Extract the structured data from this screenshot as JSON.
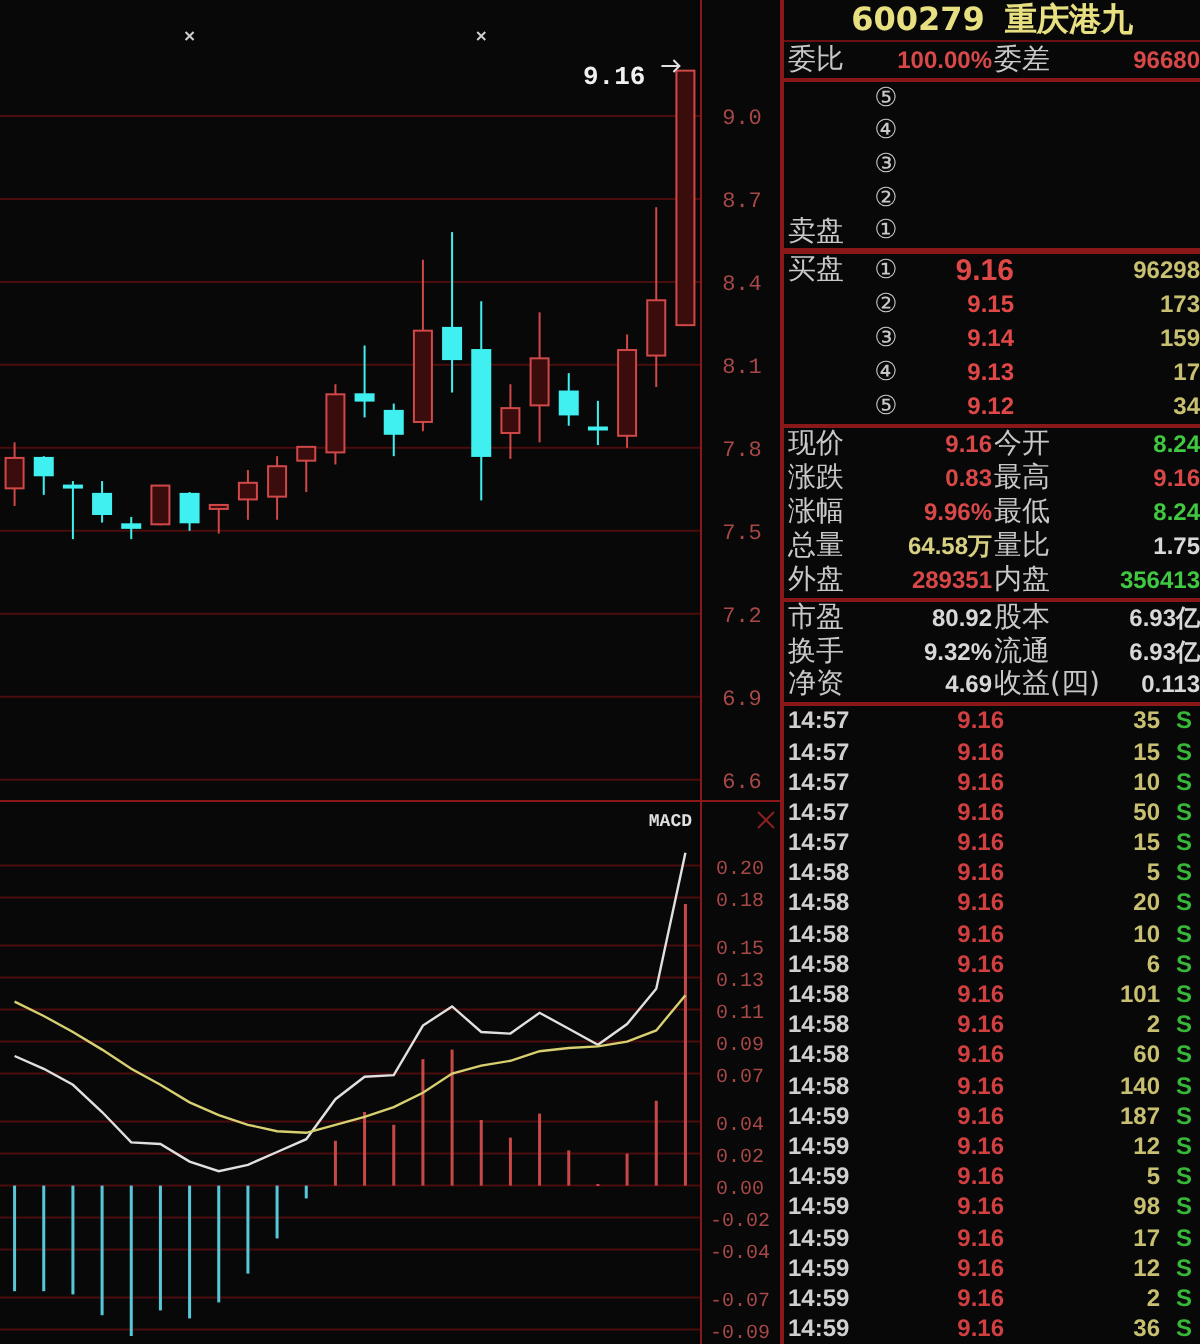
{
  "price_chart": {
    "chart_data": {
      "type": "candlestick",
      "ylim": [
        6.527,
        9.419
      ],
      "categories": [
        null,
        null,
        null,
        null,
        null,
        null,
        null,
        null,
        null,
        null,
        null,
        null,
        null,
        null,
        null,
        null,
        null,
        null,
        null,
        null,
        null,
        null,
        null,
        null
      ],
      "yticks": [
        {
          "value": 9.0,
          "label": "9.0"
        },
        {
          "value": 8.7,
          "label": "8.7"
        },
        {
          "value": 8.4,
          "label": "8.4"
        },
        {
          "value": 8.1,
          "label": "8.1"
        },
        {
          "value": 7.8,
          "label": "7.8"
        },
        {
          "value": 7.5,
          "label": "7.5"
        },
        {
          "value": 7.2,
          "label": "7.2"
        },
        {
          "value": 6.9,
          "label": "6.9"
        },
        {
          "value": 6.6,
          "label": "6.6"
        }
      ],
      "grid": true,
      "ohlc": [
        [
          7.65,
          7.82,
          7.59,
          7.76
        ],
        [
          7.76,
          7.77,
          7.63,
          7.69
        ],
        [
          7.66,
          7.68,
          7.47,
          7.65
        ],
        [
          7.63,
          7.68,
          7.53,
          7.55
        ],
        [
          7.52,
          7.55,
          7.47,
          7.5
        ],
        [
          7.52,
          7.66,
          7.52,
          7.66
        ],
        [
          7.63,
          7.64,
          7.5,
          7.52
        ],
        [
          7.58,
          7.59,
          7.49,
          7.59
        ],
        [
          7.61,
          7.72,
          7.54,
          7.67
        ],
        [
          7.62,
          7.77,
          7.54,
          7.73
        ],
        [
          7.75,
          7.8,
          7.64,
          7.8
        ],
        [
          7.78,
          8.03,
          7.74,
          7.99
        ],
        [
          7.99,
          8.17,
          7.91,
          7.96
        ],
        [
          7.93,
          7.96,
          7.77,
          7.84
        ],
        [
          7.89,
          8.48,
          7.86,
          8.22
        ],
        [
          8.23,
          8.58,
          8.0,
          8.11
        ],
        [
          8.15,
          8.33,
          7.61,
          7.76
        ],
        [
          7.85,
          8.03,
          7.76,
          7.94
        ],
        [
          7.95,
          8.29,
          7.82,
          8.12
        ],
        [
          8.0,
          8.07,
          7.88,
          7.91
        ],
        [
          7.87,
          7.97,
          7.81,
          7.86
        ],
        [
          7.84,
          8.21,
          7.8,
          8.15
        ],
        [
          8.13,
          8.67,
          8.02,
          8.33
        ],
        [
          8.24,
          9.16,
          8.24,
          9.16
        ]
      ],
      "annotations": [
        {
          "text": "9.16"
        }
      ]
    }
  },
  "macd_chart": {
    "chart_data": {
      "type": "bar",
      "title": "MACD",
      "grid": true,
      "categories": [
        null,
        null,
        null,
        null,
        null,
        null,
        null,
        null,
        null,
        null,
        null,
        null,
        null,
        null,
        null,
        null,
        null,
        null,
        null,
        null,
        null,
        null,
        null,
        null
      ],
      "ylim": [
        -0.099,
        0.241
      ],
      "yticks": [
        {
          "value": 0.2,
          "label": "0.20"
        },
        {
          "value": 0.18,
          "label": "0.18"
        },
        {
          "value": 0.15,
          "label": "0.15"
        },
        {
          "value": 0.13,
          "label": "0.13"
        },
        {
          "value": 0.11,
          "label": "0.11"
        },
        {
          "value": 0.09,
          "label": "0.09"
        },
        {
          "value": 0.07,
          "label": "0.07"
        },
        {
          "value": 0.04,
          "label": "0.04"
        },
        {
          "value": 0.02,
          "label": "0.02"
        },
        {
          "value": 0,
          "label": "0.00"
        },
        {
          "value": -0.02,
          "label": "-0.02"
        },
        {
          "value": -0.04,
          "label": "-0.04"
        },
        {
          "value": -0.07,
          "label": "-0.07"
        },
        {
          "value": -0.09,
          "label": "-0.09"
        }
      ],
      "series": [
        {
          "color": "#c84848",
          "values": [
            null,
            null,
            null,
            null,
            null,
            null,
            null,
            null,
            null,
            null,
            null,
            0.028,
            0.046,
            0.038,
            0.079,
            0.085,
            0.041,
            0.03,
            0.045,
            0.022,
            0.001,
            0.02,
            0.053,
            0.176
          ]
        },
        {
          "color": "#58c8d8",
          "values": [
            -0.066,
            -0.066,
            -0.068,
            -0.081,
            -0.094,
            -0.078,
            -0.083,
            -0.073,
            -0.055,
            -0.033,
            -0.008,
            null,
            null,
            null,
            null,
            null,
            null,
            null,
            null,
            null,
            null,
            null,
            null,
            null
          ]
        },
        {
          "type": "line",
          "color": "#e0e0e0",
          "values": [
            0.081,
            0.073,
            0.063,
            0.046,
            0.027,
            0.026,
            0.015,
            0.009,
            0.013,
            0.021,
            0.029,
            0.054,
            0.068,
            0.069,
            0.1,
            0.112,
            0.096,
            0.095,
            0.108,
            0.098,
            0.088,
            0.101,
            0.123,
            0.208
          ]
        },
        {
          "type": "line",
          "color": "#d8d070",
          "values": [
            0.115,
            0.106,
            0.096,
            0.085,
            0.073,
            0.063,
            0.052,
            0.044,
            0.038,
            0.034,
            0.033,
            0.038,
            0.043,
            0.049,
            0.058,
            0.07,
            0.075,
            0.078,
            0.084,
            0.086,
            0.087,
            0.09,
            0.097,
            0.119
          ]
        }
      ]
    }
  },
  "quote": {
    "code": "600279",
    "name": "重庆港九",
    "ratio": [
      {
        "label": "委比",
        "value": "100.00%",
        "color": "#d84848"
      },
      {
        "label": "委差",
        "value": "96680",
        "color": "#d84848"
      }
    ],
    "sell_orders": [
      {
        "level": "⑤"
      },
      {
        "level": "④"
      },
      {
        "level": "③"
      },
      {
        "level": "②"
      },
      {
        "level": "①",
        "side_label": "卖盘"
      }
    ],
    "buy_orders": [
      {
        "side_label": "买盘",
        "level": "①",
        "price": "9.16",
        "volume": "96298",
        "emphasized": true
      },
      {
        "level": "②",
        "price": "9.15",
        "volume": "173",
        "emphasized": false
      },
      {
        "level": "③",
        "price": "9.14",
        "volume": "159",
        "emphasized": false
      },
      {
        "level": "④",
        "price": "9.13",
        "volume": "17",
        "emphasized": false
      },
      {
        "level": "⑤",
        "price": "9.12",
        "volume": "34",
        "emphasized": false
      }
    ],
    "stats": [
      {
        "label": "现价",
        "value": "9.16",
        "color": "#d84848"
      },
      {
        "label": "今开",
        "value": "8.24",
        "color": "#40c840"
      },
      {
        "label": "涨跌",
        "value": "0.83",
        "color": "#d84848"
      },
      {
        "label": "最高",
        "value": "9.16",
        "color": "#d84848"
      },
      {
        "label": "涨幅",
        "value": "9.96%",
        "color": "#d84848"
      },
      {
        "label": "最低",
        "value": "8.24",
        "color": "#40c840"
      },
      {
        "label": "总量",
        "value": "64.58万",
        "color": "#d8d080"
      },
      {
        "label": "量比",
        "value": "1.75",
        "color": "#d8d8d8"
      },
      {
        "label": "外盘",
        "value": "289351",
        "color": "#d84848"
      },
      {
        "label": "内盘",
        "value": "356413",
        "color": "#40c840"
      }
    ],
    "fundamentals": [
      {
        "label": "市盈",
        "value": "80.92",
        "color": "#d8d8d8"
      },
      {
        "label": "股本",
        "value": "6.93亿",
        "color": "#d8d8d8"
      },
      {
        "label": "换手",
        "value": "9.32%",
        "color": "#d8d8d8"
      },
      {
        "label": "流通",
        "value": "6.93亿",
        "color": "#d8d8d8"
      },
      {
        "label": "净资",
        "value": "4.69",
        "color": "#d8d8d8"
      },
      {
        "label": "收益(四)",
        "value": "0.113",
        "color": "#d8d8d8"
      }
    ]
  },
  "trades": [
    {
      "time": "14:57",
      "price": "9.16",
      "volume": "35",
      "side": "S"
    },
    {
      "time": "14:57",
      "price": "9.16",
      "volume": "15",
      "side": "S"
    },
    {
      "time": "14:57",
      "price": "9.16",
      "volume": "10",
      "side": "S"
    },
    {
      "time": "14:57",
      "price": "9.16",
      "volume": "50",
      "side": "S"
    },
    {
      "time": "14:57",
      "price": "9.16",
      "volume": "15",
      "side": "S"
    },
    {
      "time": "14:58",
      "price": "9.16",
      "volume": "5",
      "side": "S"
    },
    {
      "time": "14:58",
      "price": "9.16",
      "volume": "20",
      "side": "S"
    },
    {
      "time": "14:58",
      "price": "9.16",
      "volume": "10",
      "side": "S"
    },
    {
      "time": "14:58",
      "price": "9.16",
      "volume": "6",
      "side": "S"
    },
    {
      "time": "14:58",
      "price": "9.16",
      "volume": "101",
      "side": "S"
    },
    {
      "time": "14:58",
      "price": "9.16",
      "volume": "2",
      "side": "S"
    },
    {
      "time": "14:58",
      "price": "9.16",
      "volume": "60",
      "side": "S"
    },
    {
      "time": "14:58",
      "price": "9.16",
      "volume": "140",
      "side": "S"
    },
    {
      "time": "14:59",
      "price": "9.16",
      "volume": "187",
      "side": "S"
    },
    {
      "time": "14:59",
      "price": "9.16",
      "volume": "12",
      "side": "S"
    },
    {
      "time": "14:59",
      "price": "9.16",
      "volume": "5",
      "side": "S"
    },
    {
      "time": "14:59",
      "price": "9.16",
      "volume": "98",
      "side": "S"
    },
    {
      "time": "14:59",
      "price": "9.16",
      "volume": "17",
      "side": "S"
    },
    {
      "time": "14:59",
      "price": "9.16",
      "volume": "12",
      "side": "S"
    },
    {
      "time": "14:59",
      "price": "9.16",
      "volume": "2",
      "side": "S"
    },
    {
      "time": "14:59",
      "price": "9.16",
      "volume": "36",
      "side": "S"
    }
  ]
}
